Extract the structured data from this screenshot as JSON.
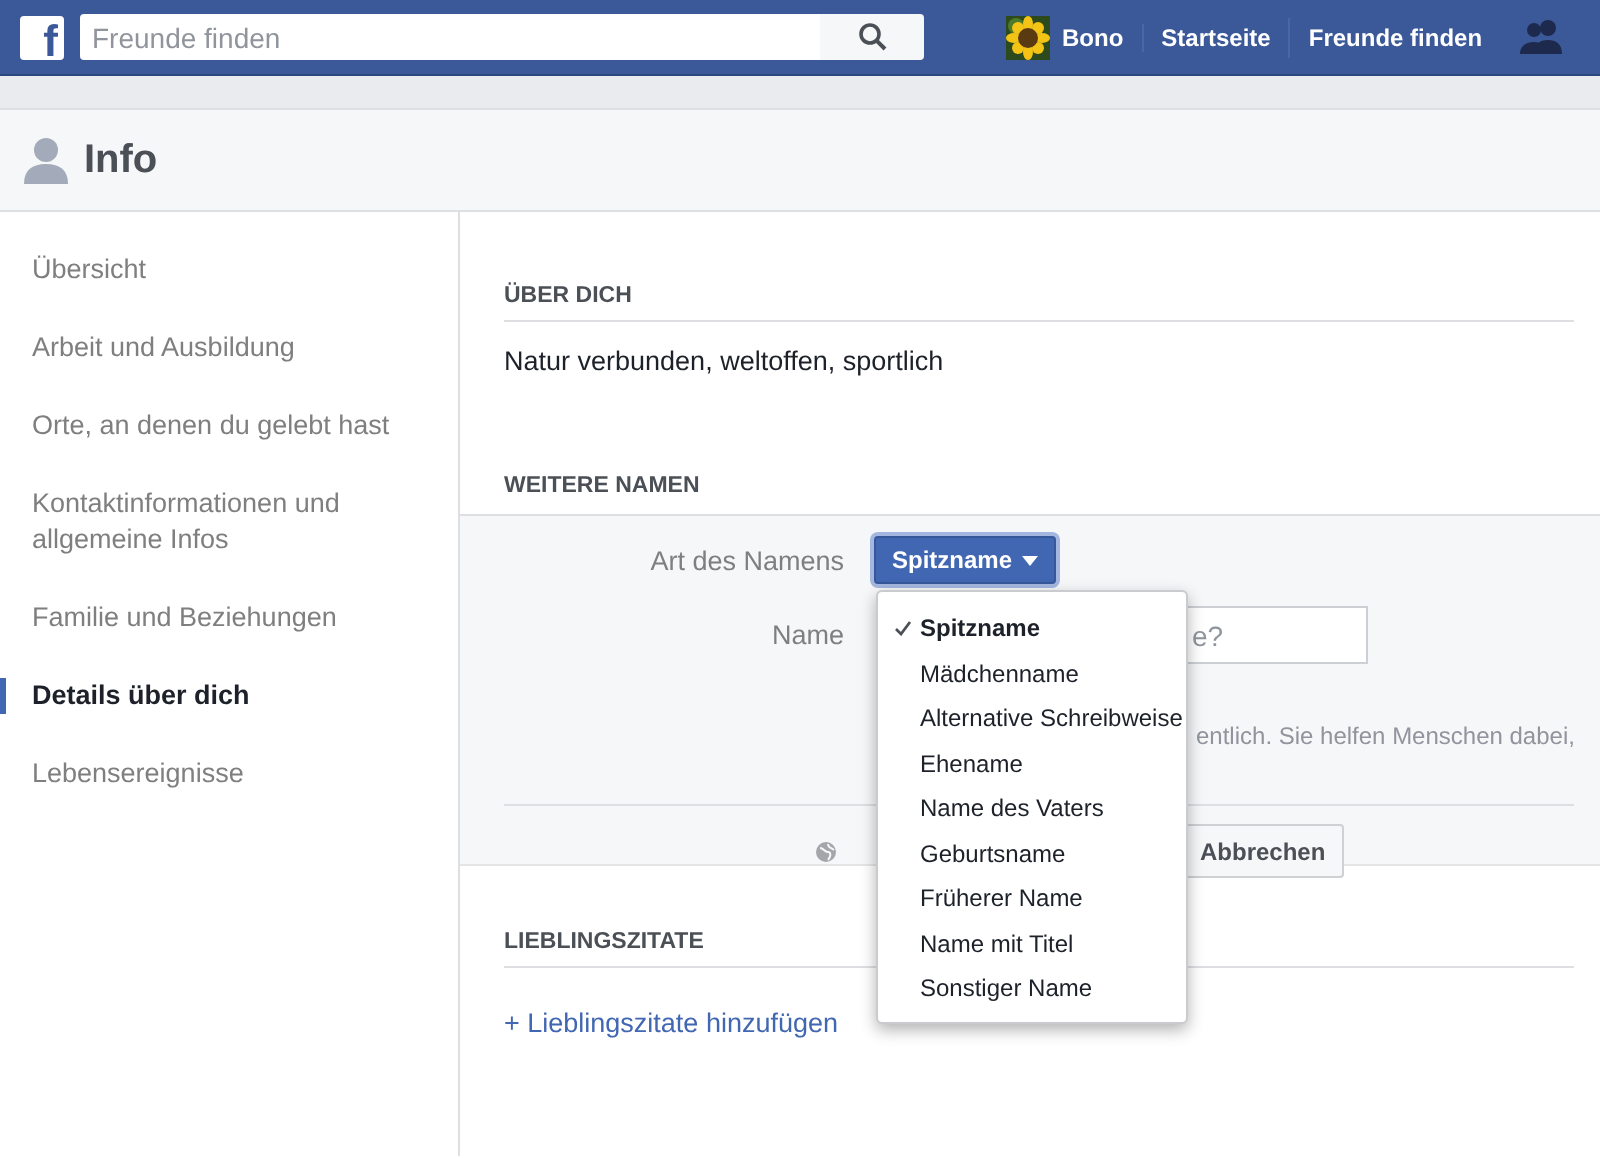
{
  "top_bar": {
    "logo": "f",
    "search": {
      "placeholder": "Freunde finden"
    },
    "profile": {
      "name": "Bono"
    },
    "nav": [
      "Startseite",
      "Freunde finden"
    ]
  },
  "page_header": {
    "title": "Info"
  },
  "sidebar": {
    "items": [
      {
        "label": "Übersicht",
        "selected": false
      },
      {
        "label": "Arbeit und Ausbildung",
        "selected": false
      },
      {
        "label": "Orte, an denen du gelebt hast",
        "selected": false
      },
      {
        "label": "Kontaktinformationen und allgemeine Infos",
        "selected": false
      },
      {
        "label": "Familie und Beziehungen",
        "selected": false
      },
      {
        "label": "Details über dich",
        "selected": true
      },
      {
        "label": "Lebensereignisse",
        "selected": false
      }
    ]
  },
  "about": {
    "heading": "ÜBER DICH",
    "text": "Natur verbunden, weltoffen, sportlich"
  },
  "other_names": {
    "heading": "WEITERE NAMEN",
    "type_label": "Art des Namens",
    "type_value": "Spitzname",
    "name_label": "Name",
    "name_placeholder": "e?",
    "help_text": "entlich. Sie helfen Menschen dabei,",
    "cancel_button": "Abbrechen",
    "dropdown": [
      {
        "label": "Spitzname",
        "selected": true
      },
      {
        "label": "Mädchenname",
        "selected": false
      },
      {
        "label": "Alternative Schreibweise",
        "selected": false
      },
      {
        "label": "Ehename",
        "selected": false
      },
      {
        "label": "Name des Vaters",
        "selected": false
      },
      {
        "label": "Geburtsname",
        "selected": false
      },
      {
        "label": "Früherer Name",
        "selected": false
      },
      {
        "label": "Name mit Titel",
        "selected": false
      },
      {
        "label": "Sonstiger Name",
        "selected": false
      }
    ]
  },
  "quotes": {
    "heading": "LIEBLINGSZITATE",
    "add_link": "+ Lieblingszitate hinzufügen"
  }
}
